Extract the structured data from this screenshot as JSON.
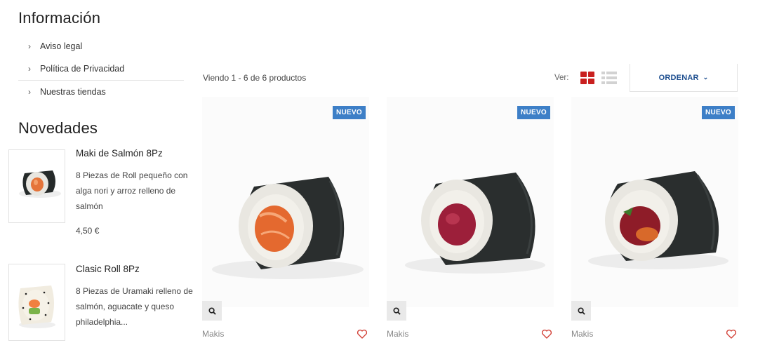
{
  "sidebar": {
    "info_title": "Información",
    "info_links": [
      "Aviso legal",
      "Política de Privacidad",
      "Nuestras tiendas"
    ],
    "novedades_title": "Novedades",
    "novedades": [
      {
        "name": "Maki de Salmón 8Pz",
        "desc": "8 Piezas de Roll pequeño con alga nori y arroz relleno de salmón",
        "price": "4,50 €"
      },
      {
        "name": "Clasic Roll 8Pz",
        "desc": "8 Piezas de Uramaki relleno de salmón, aguacate y queso philadelphia..."
      }
    ]
  },
  "toolbar": {
    "count_text": "Viendo 1 - 6 de 6 productos",
    "view_label": "Ver:",
    "sort_label": "ORDENAR",
    "sort_arrow": "⌄"
  },
  "products": [
    {
      "badge": "NUEVO",
      "category": "Makis",
      "filling": "salmon"
    },
    {
      "badge": "NUEVO",
      "category": "Makis",
      "filling": "tuna"
    },
    {
      "badge": "NUEVO",
      "category": "Makis",
      "filling": "spicy-tuna"
    }
  ],
  "colors": {
    "accent_red": "#c9201f",
    "badge_blue": "#3d7fc7",
    "sort_blue": "#1d4e8f",
    "heart_red": "#d0392f"
  },
  "icons": {
    "chevron": "chevron-right-icon",
    "quick_view": "search-icon",
    "wishlist": "heart-icon",
    "grid_view": "grid-icon",
    "list_view": "list-icon"
  }
}
